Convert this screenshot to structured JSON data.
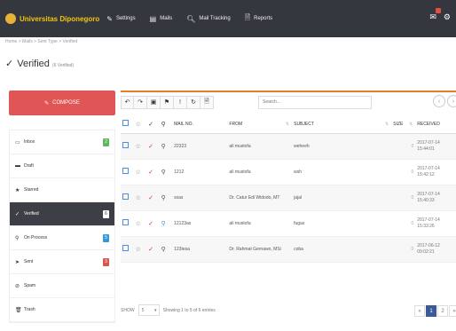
{
  "app": {
    "brand": "Universitas Diponegoro"
  },
  "nav": [
    {
      "label": "Settings",
      "icon": "wrench-icon"
    },
    {
      "label": "Mails",
      "icon": "list-icon"
    },
    {
      "label": "Mail Tracking",
      "icon": "search-icon"
    },
    {
      "label": "Reports",
      "icon": "document-icon"
    }
  ],
  "breadcrumb": "Home > Mails > Sent Type > Verified",
  "page": {
    "title": "Verified",
    "subtitle": "(6 Verified)"
  },
  "compose_label": "COMPOSE",
  "folders": [
    {
      "label": "Inbox",
      "icon": "inbox-icon",
      "count": "2",
      "color": "#5cb85c"
    },
    {
      "label": "Draft",
      "icon": "file-icon",
      "count": "",
      "color": ""
    },
    {
      "label": "Starred",
      "icon": "star-icon",
      "count": "",
      "color": ""
    },
    {
      "label": "Verified",
      "icon": "verified-icon",
      "count": "6",
      "color": "#ffffff",
      "active": true
    },
    {
      "label": "On Process",
      "icon": "pin-icon",
      "count": "5",
      "color": "#3498db"
    },
    {
      "label": "Sent",
      "icon": "send-icon",
      "count": "3",
      "color": "#d9534f"
    },
    {
      "label": "Spam",
      "icon": "spam-icon",
      "count": "",
      "color": ""
    },
    {
      "label": "Trash",
      "icon": "trash-icon",
      "count": "",
      "color": ""
    }
  ],
  "search": {
    "placeholder": "Search..."
  },
  "table": {
    "headers": {
      "mailno": "MAIL NO.",
      "from": "FROM",
      "subject": "SUBJECT",
      "size": "SIZE",
      "received": "RECEIVED"
    },
    "rows": [
      {
        "mailno": "22323",
        "from": "ali mustofa",
        "subject": "weheeh",
        "size": "0",
        "date": "2017-07-14",
        "time": "15:44:01"
      },
      {
        "mailno": "1212",
        "from": "ali mustofa",
        "subject": "wsh",
        "size": "0",
        "date": "2017-07-14",
        "time": "15:42:12"
      },
      {
        "mailno": "sxas",
        "from": "Dr. Catur Edi Widodo, MT",
        "subject": "jajal",
        "size": "0",
        "date": "2017-07-14",
        "time": "15:40:33"
      },
      {
        "mailno": "12123as",
        "from": "ali mustofa",
        "subject": "fugas",
        "size": "0",
        "date": "2017-07-14",
        "time": "15:33:26"
      },
      {
        "mailno": "123tesa",
        "from": "Dr. Rahmat Gernawo, MSi",
        "subject": "coba",
        "size": "0",
        "date": "2017-06-12",
        "time": "09:02:21"
      }
    ]
  },
  "footer": {
    "show_label": "SHOW",
    "show_value": "5",
    "info": "Showing 1 to 5 of 6 entries"
  },
  "pagination": [
    "«",
    "1",
    "2",
    "»"
  ]
}
